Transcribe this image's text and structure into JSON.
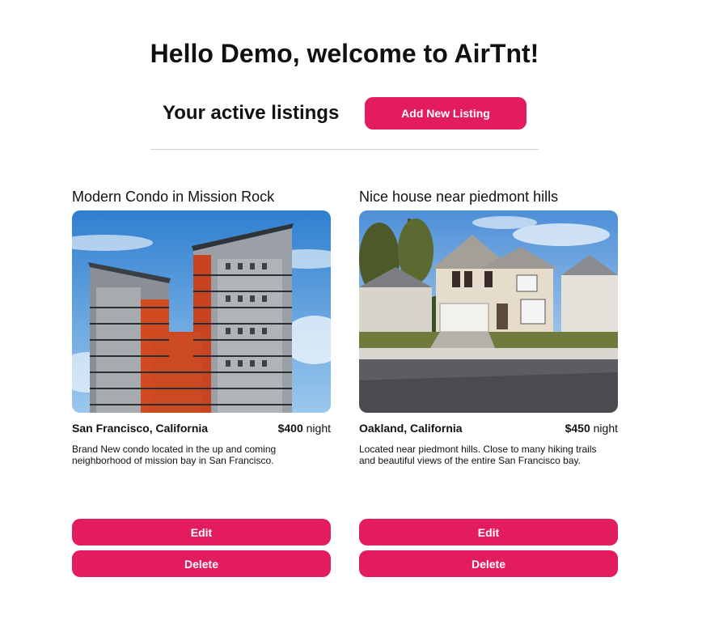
{
  "header": {
    "greeting": "Hello Demo, welcome to AirTnt!"
  },
  "listings_section": {
    "title": "Your active listings",
    "add_button_label": "Add New Listing"
  },
  "listings": [
    {
      "title": "Modern Condo in Mission Rock",
      "image_subject": "high-rise apartment towers against blue sky",
      "location": "San Francisco, California",
      "price": "$400",
      "price_unit": "night",
      "description": "Brand New condo located in the up and coming neighborhood of mission bay in San Francisco.",
      "edit_label": "Edit",
      "delete_label": "Delete"
    },
    {
      "title": "Nice house near piedmont hills",
      "image_subject": "two-story suburban house with garage and trees",
      "location": "Oakland, California",
      "price": "$450",
      "price_unit": "night",
      "description": "Located near piedmont hills. Close to many hiking trails and beautiful views of the entire San Francisco bay.",
      "edit_label": "Edit",
      "delete_label": "Delete"
    }
  ],
  "colors": {
    "accent": "#e31c5f",
    "divider": "#d0d0d0"
  }
}
